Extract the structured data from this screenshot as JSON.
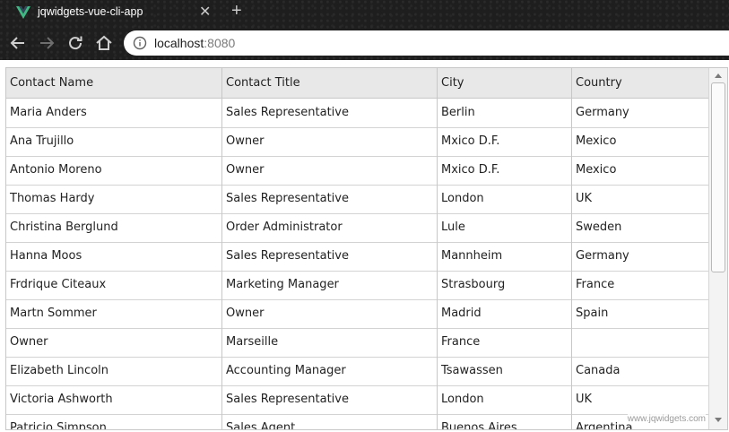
{
  "browser": {
    "tab_title": "jqwidgets-vue-cli-app",
    "tab_close": "✕",
    "new_tab": "+",
    "url_host": "localhost",
    "url_port": ":8080",
    "icons": [
      "back-icon",
      "forward-icon",
      "reload-icon",
      "home-icon",
      "info-icon",
      "vue-logo"
    ]
  },
  "grid": {
    "columns": [
      "Contact Name",
      "Contact Title",
      "City",
      "Country"
    ],
    "rows": [
      [
        "Maria Anders",
        "Sales Representative",
        "Berlin",
        "Germany"
      ],
      [
        "Ana Trujillo",
        "Owner",
        "Mxico D.F.",
        "Mexico"
      ],
      [
        "Antonio Moreno",
        "Owner",
        "Mxico D.F.",
        "Mexico"
      ],
      [
        "Thomas Hardy",
        "Sales Representative",
        "London",
        "UK"
      ],
      [
        "Christina Berglund",
        "Order Administrator",
        "Lule",
        "Sweden"
      ],
      [
        "Hanna Moos",
        "Sales Representative",
        "Mannheim",
        "Germany"
      ],
      [
        "Frdrique Citeaux",
        "Marketing Manager",
        "Strasbourg",
        "France"
      ],
      [
        "Martn Sommer",
        "Owner",
        "Madrid",
        "Spain"
      ],
      [
        "Owner",
        "Marseille",
        "France",
        ""
      ],
      [
        "Elizabeth Lincoln",
        "Accounting Manager",
        "Tsawassen",
        "Canada"
      ],
      [
        "Victoria Ashworth",
        "Sales Representative",
        "London",
        "UK"
      ],
      [
        "Patricio Simpson",
        "Sales Agent",
        "Buenos Aires",
        "Argentina"
      ]
    ],
    "watermark": "www.jqwidgets.com"
  },
  "colors": {
    "chrome_bg": "#1e1e1e",
    "header_bg": "#e8e8e8",
    "border": "#c7c7c7",
    "vue_green": "#41b883",
    "vue_dark": "#35495e"
  }
}
